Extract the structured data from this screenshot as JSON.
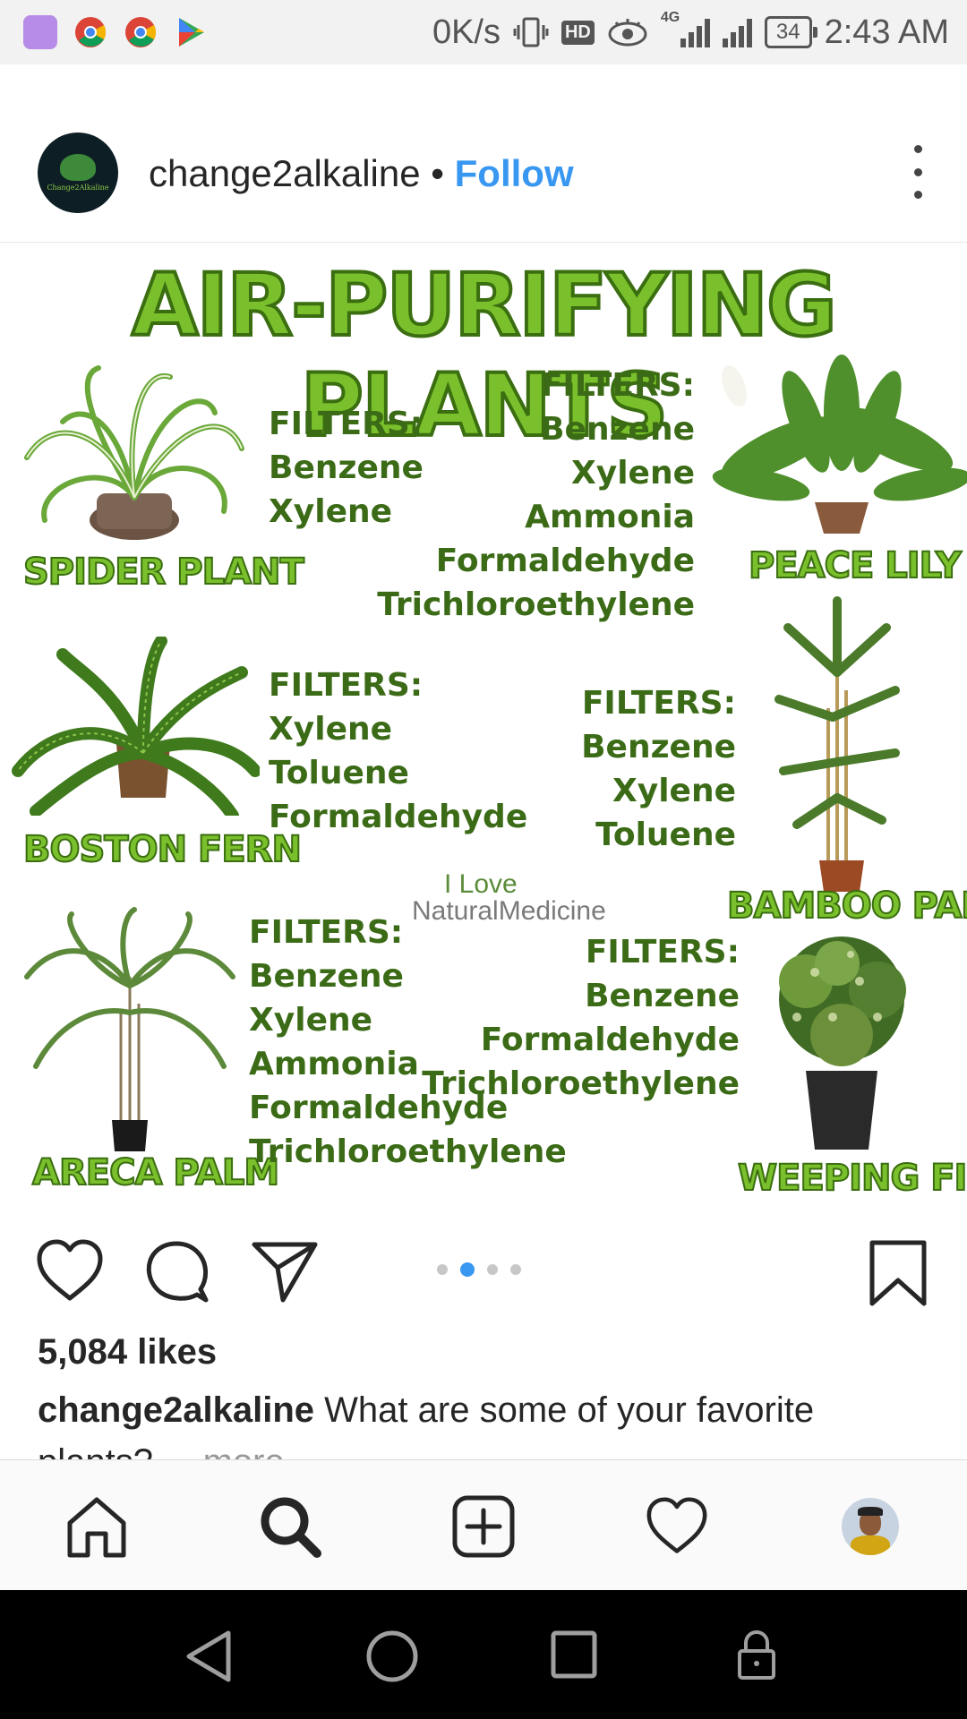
{
  "status_bar": {
    "speed": "0K/s",
    "hd": "HD",
    "network": "4G",
    "battery": "34",
    "time": "2:43 AM"
  },
  "post": {
    "username": "change2alkaline",
    "separator": "•",
    "follow_label": "Follow",
    "avatar_brand": "Change2Alkaline"
  },
  "infographic": {
    "title": "AIR-PURIFYING PLANTS",
    "filters_label": "FILTERS:",
    "plants": [
      {
        "name": "SPIDER PLANT",
        "filters": [
          "Benzene",
          "Xylene"
        ]
      },
      {
        "name": "PEACE LILY",
        "filters": [
          "Benzene",
          "Xylene",
          "Ammonia",
          "Formaldehyde",
          "Trichloroethylene"
        ]
      },
      {
        "name": "BOSTON FERN",
        "filters": [
          "Xylene",
          "Toluene",
          "Formaldehyde"
        ]
      },
      {
        "name": "BAMBOO PALM",
        "filters": [
          "Benzene",
          "Xylene",
          "Toluene"
        ]
      },
      {
        "name": "ARECA PALM",
        "filters": [
          "Benzene",
          "Xylene",
          "Ammonia",
          "Formaldehyde",
          "Trichloroethylene"
        ]
      },
      {
        "name": "WEEPING FIG",
        "filters": [
          "Benzene",
          "Formaldehyde",
          "Trichloroethylene"
        ]
      }
    ],
    "watermark": {
      "line1": "I Love",
      "line2": "NaturalMedicine"
    }
  },
  "carousel": {
    "count": 4,
    "active_index": 1
  },
  "engagement": {
    "likes": "5,084 likes",
    "caption_user": "change2alkaline",
    "caption_text": "What are some of your favorite plants?",
    "more_label": "... more"
  },
  "colors": {
    "accent": "#3897f0",
    "title_green": "#7ac02c",
    "text_green": "#3b6b16"
  },
  "icons": {
    "actions": [
      "heart-icon",
      "comment-icon",
      "share-icon",
      "bookmark-icon"
    ],
    "nav": [
      "home-icon",
      "search-icon",
      "add-post-icon",
      "activity-heart-icon",
      "profile-avatar"
    ],
    "system": [
      "back-icon",
      "home-circle-icon",
      "recents-icon",
      "lock-icon"
    ]
  }
}
